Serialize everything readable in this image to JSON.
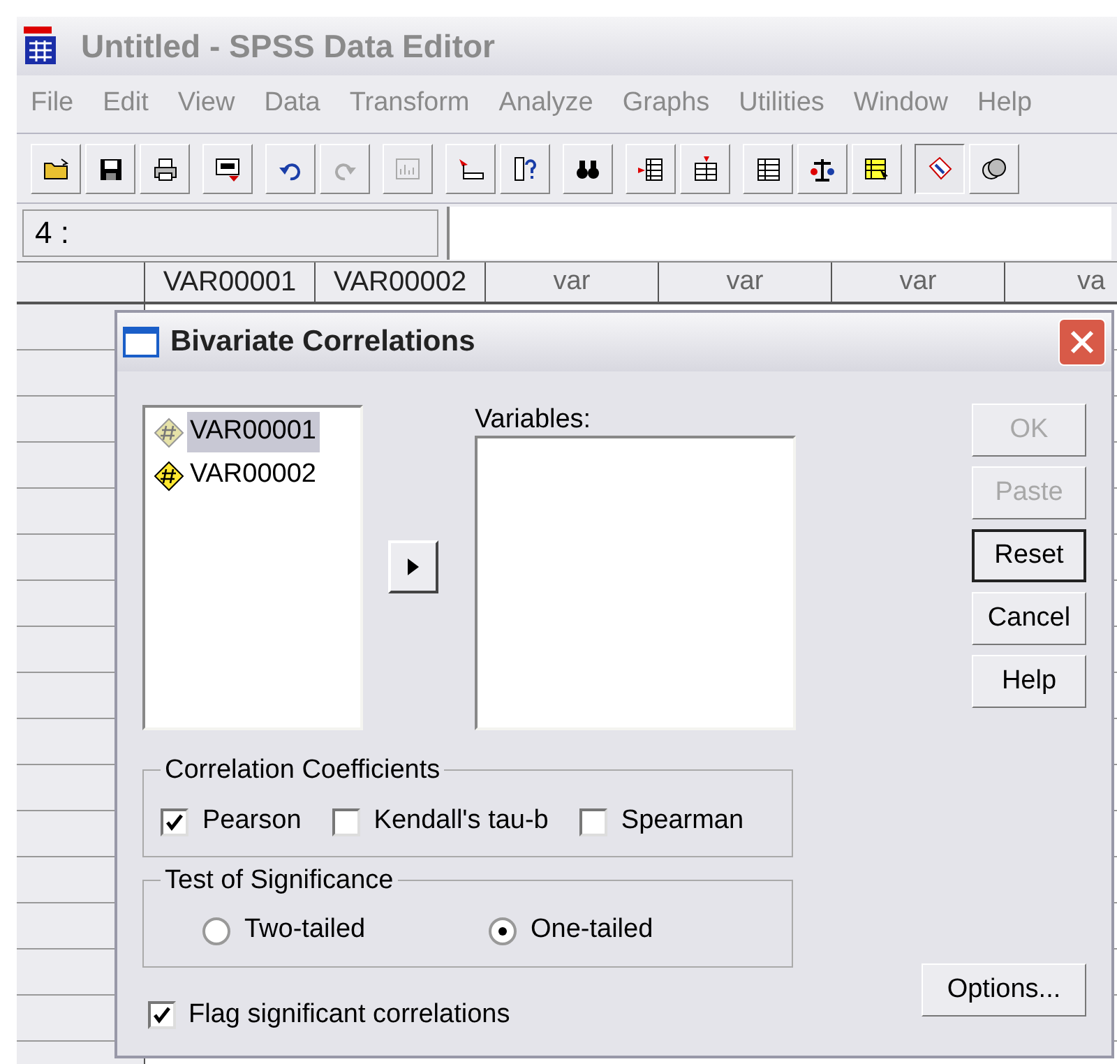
{
  "window": {
    "title": "Untitled - SPSS Data Editor"
  },
  "menu": [
    "File",
    "Edit",
    "View",
    "Data",
    "Transform",
    "Analyze",
    "Graphs",
    "Utilities",
    "Window",
    "Help"
  ],
  "cell_editor": {
    "cell_ref": "4 :"
  },
  "grid": {
    "columns": [
      "VAR00001",
      "VAR00002",
      "var",
      "var",
      "var",
      "va"
    ]
  },
  "dialog": {
    "title": "Bivariate Correlations",
    "source_list": [
      {
        "label": "VAR00001",
        "selected": true
      },
      {
        "label": "VAR00002",
        "selected": false
      }
    ],
    "target_label": "Variables:",
    "buttons": [
      {
        "label": "OK",
        "disabled": true,
        "default": false
      },
      {
        "label": "Paste",
        "disabled": true,
        "default": false
      },
      {
        "label": "Reset",
        "disabled": false,
        "default": true
      },
      {
        "label": "Cancel",
        "disabled": false,
        "default": false
      },
      {
        "label": "Help",
        "disabled": false,
        "default": false
      }
    ],
    "coefficients": {
      "title": "Correlation Coefficients",
      "options": [
        {
          "label": "Pearson",
          "checked": true
        },
        {
          "label": "Kendall's tau-b",
          "checked": false
        },
        {
          "label": "Spearman",
          "checked": false
        }
      ]
    },
    "significance": {
      "title": "Test of Significance",
      "options": [
        {
          "label": "Two-tailed",
          "selected": false
        },
        {
          "label": "One-tailed",
          "selected": true
        }
      ]
    },
    "flag": {
      "label": "Flag significant correlations",
      "checked": true
    },
    "options_button": "Options..."
  }
}
